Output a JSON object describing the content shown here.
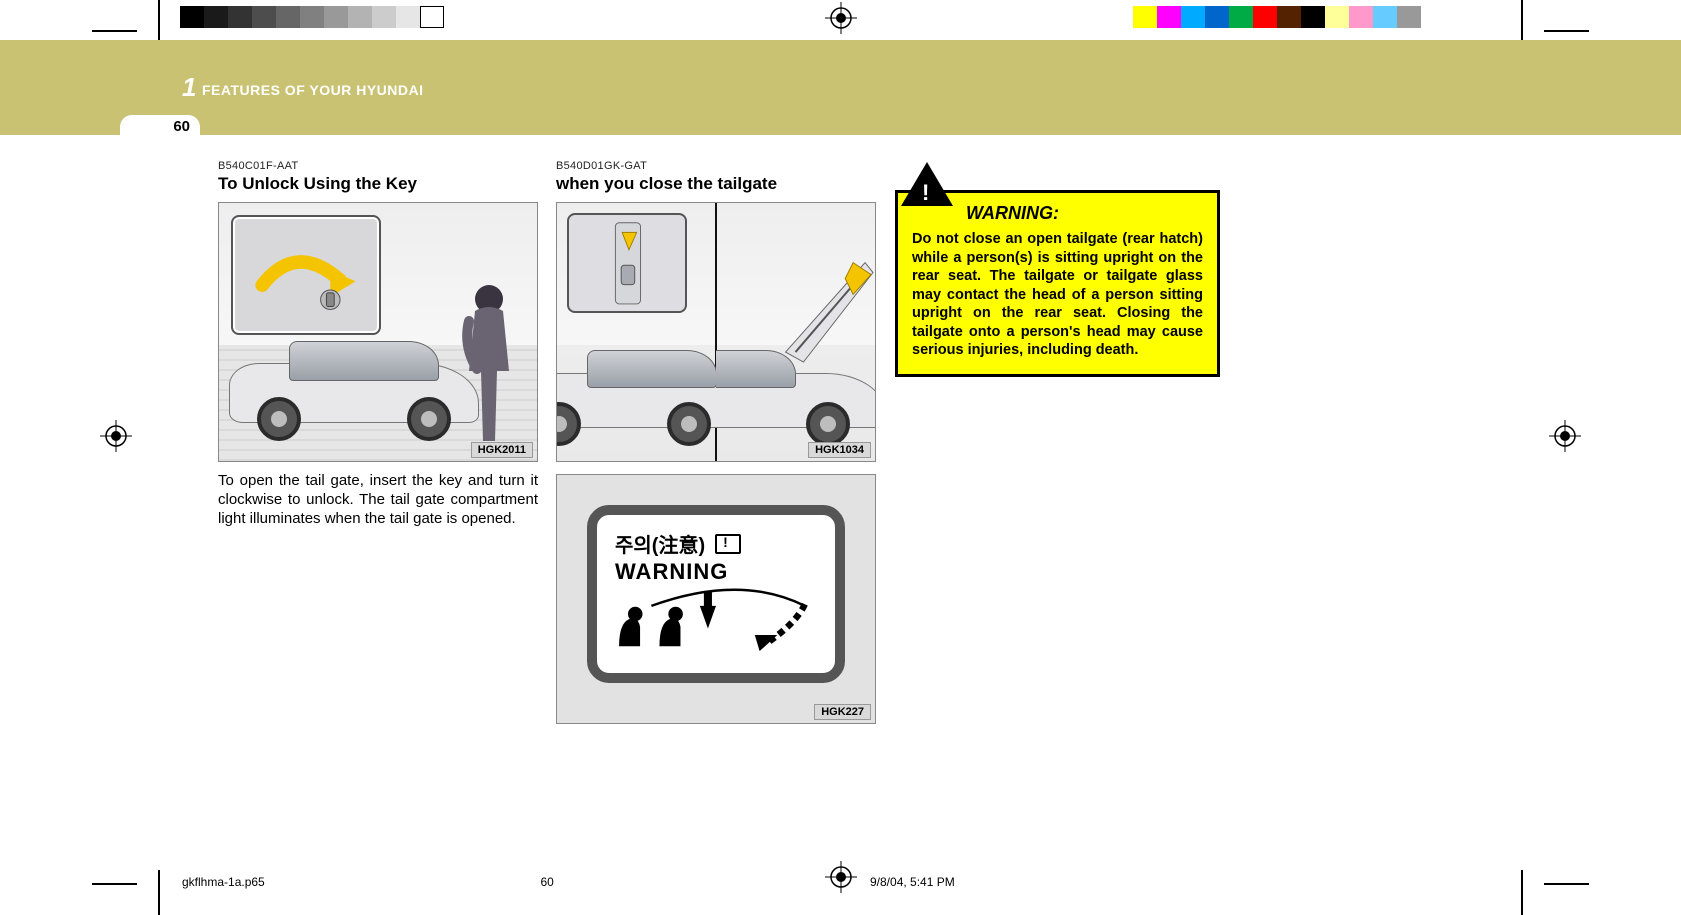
{
  "header": {
    "chapter_number": "1",
    "chapter_title": "FEATURES OF YOUR HYUNDAI",
    "page_number": "60"
  },
  "col1": {
    "code": "B540C01F-AAT",
    "heading": "To Unlock Using the Key",
    "figure_ref": "HGK2011",
    "body": "To open the tail gate, insert the key and turn it clockwise to unlock. The tail gate compartment light illuminates when the tail gate is opened."
  },
  "col2": {
    "code": "B540D01GK-GAT",
    "heading": "when you close the tailgate",
    "figure_a_ref": "HGK1034",
    "figure_b_ref": "HGK227",
    "label_korean": "주의(注意)",
    "label_english": "WARNING"
  },
  "warning": {
    "heading": "WARNING:",
    "body": "Do not close an open tailgate (rear hatch) while a person(s) is sitting upright on the rear seat. The tailgate or tailgate glass may contact the head of a person sitting upright on the rear seat. Closing the tailgate onto a person's head may cause serious injuries, including death."
  },
  "footer": {
    "filename": "gkflhma-1a.p65",
    "page": "60",
    "timestamp": "9/8/04, 5:41 PM"
  },
  "marks": {
    "registration_icon": "registration-target-icon",
    "crop_icon": "crop-mark-icon"
  }
}
